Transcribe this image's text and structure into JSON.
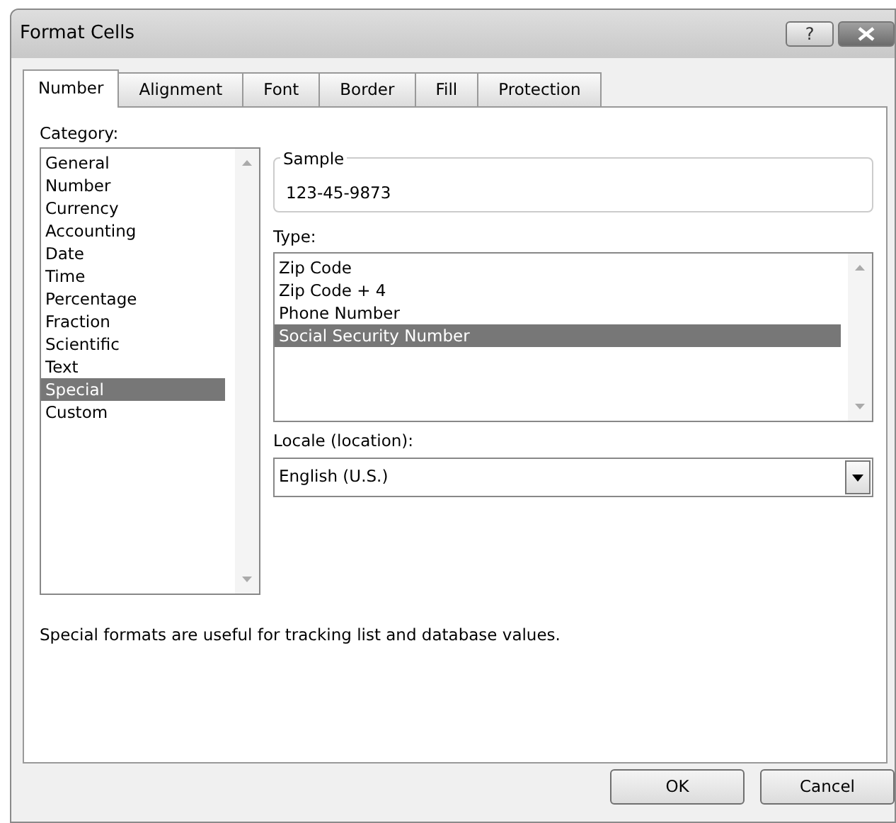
{
  "window": {
    "title": "Format Cells",
    "help_button": "?"
  },
  "tabs": [
    {
      "label": "Number",
      "selected": true
    },
    {
      "label": "Alignment",
      "selected": false
    },
    {
      "label": "Font",
      "selected": false
    },
    {
      "label": "Border",
      "selected": false
    },
    {
      "label": "Fill",
      "selected": false
    },
    {
      "label": "Protection",
      "selected": false
    }
  ],
  "category": {
    "label": "Category:",
    "items": [
      {
        "label": "General",
        "selected": false
      },
      {
        "label": "Number",
        "selected": false
      },
      {
        "label": "Currency",
        "selected": false
      },
      {
        "label": "Accounting",
        "selected": false
      },
      {
        "label": "Date",
        "selected": false
      },
      {
        "label": "Time",
        "selected": false
      },
      {
        "label": "Percentage",
        "selected": false
      },
      {
        "label": "Fraction",
        "selected": false
      },
      {
        "label": "Scientific",
        "selected": false
      },
      {
        "label": "Text",
        "selected": false
      },
      {
        "label": "Special",
        "selected": true
      },
      {
        "label": "Custom",
        "selected": false
      }
    ]
  },
  "sample": {
    "label": "Sample",
    "value": "123-45-9873"
  },
  "type": {
    "label": "Type:",
    "items": [
      {
        "label": "Zip Code",
        "selected": false
      },
      {
        "label": "Zip Code + 4",
        "selected": false
      },
      {
        "label": "Phone Number",
        "selected": false
      },
      {
        "label": "Social Security Number",
        "selected": true
      }
    ]
  },
  "locale": {
    "label": "Locale (location):",
    "value": "English (U.S.)"
  },
  "description": "Special formats are useful for tracking list and database values.",
  "buttons": [
    "OK",
    "Cancel"
  ]
}
